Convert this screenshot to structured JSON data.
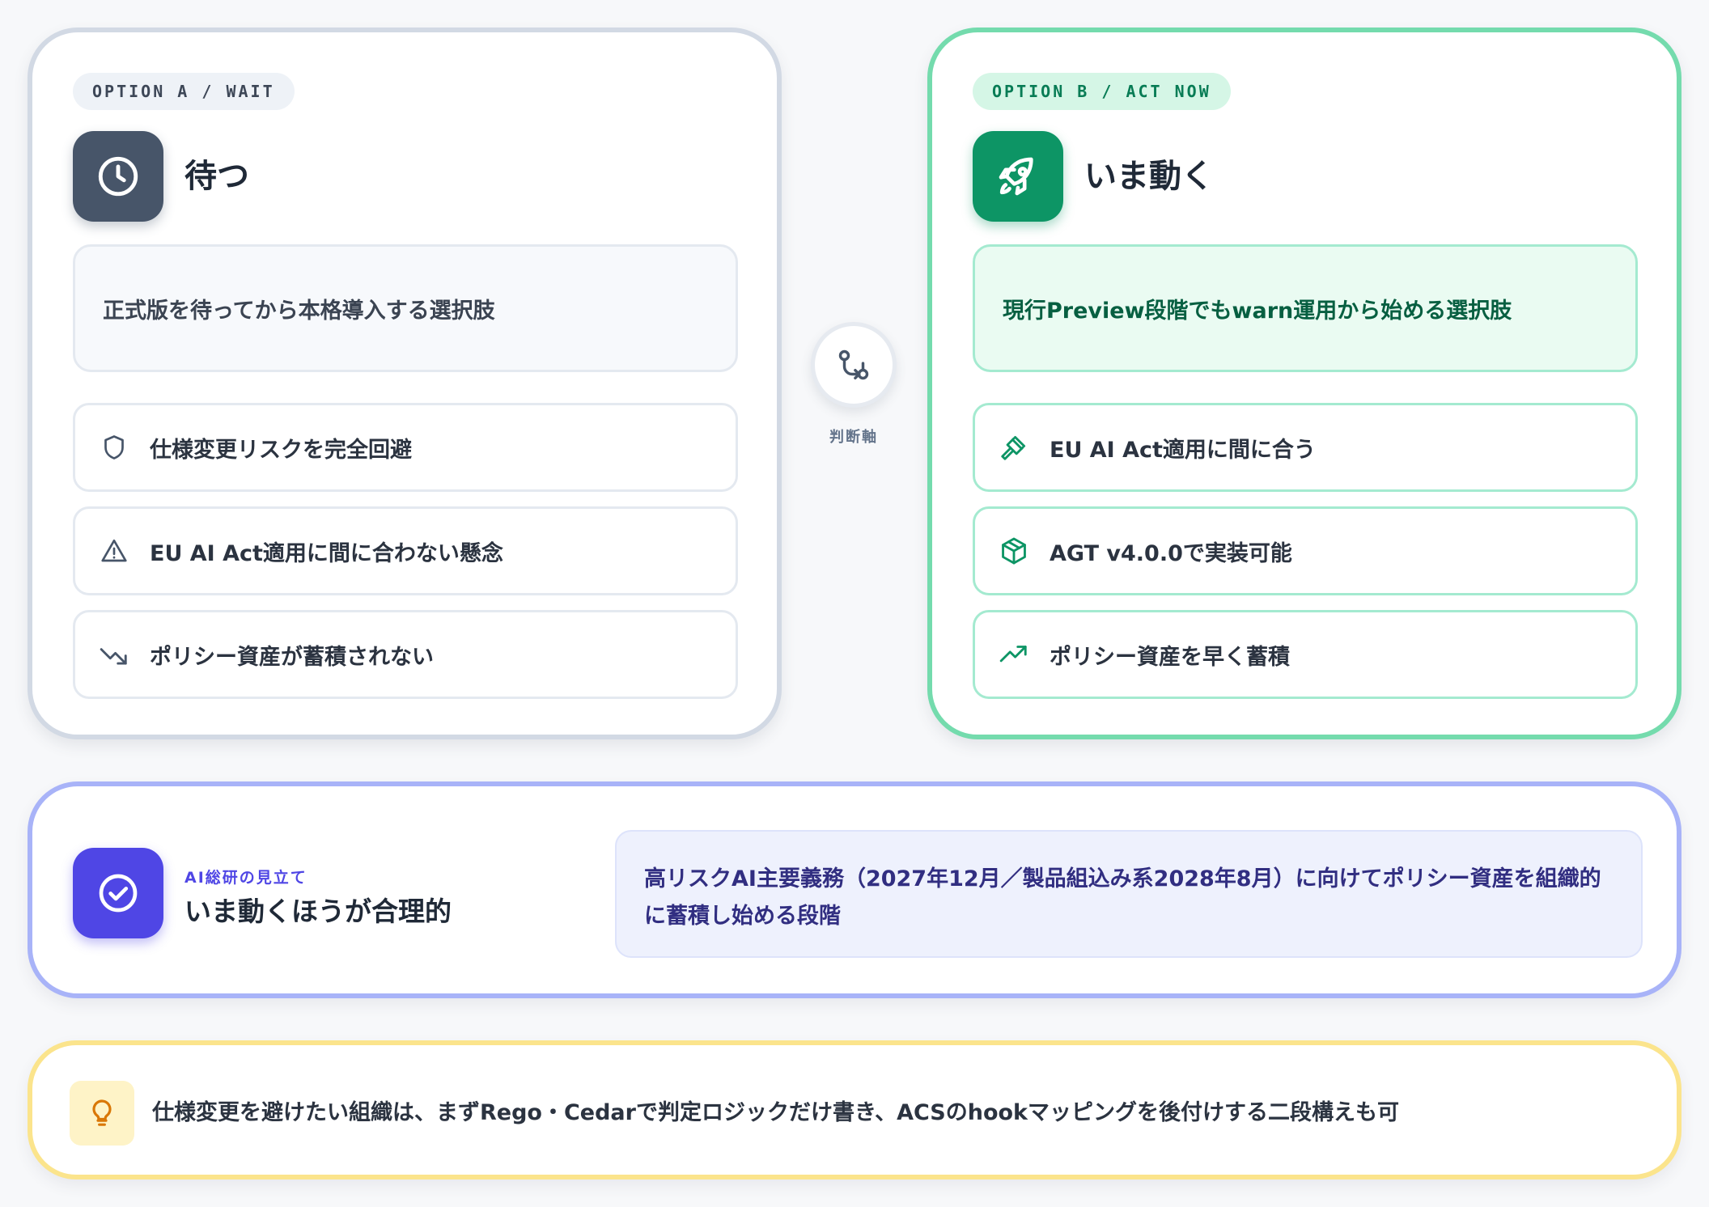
{
  "option_a": {
    "badge": "OPTION A / WAIT",
    "title": "待つ",
    "icon": "clock-icon",
    "description": "正式版を待ってから本格導入する選択肢",
    "points": [
      {
        "icon": "shield-icon",
        "text": "仕様変更リスクを完全回避"
      },
      {
        "icon": "warning-icon",
        "text": "EU AI Act適用に間に合わない懸念"
      },
      {
        "icon": "trending-down-icon",
        "text": "ポリシー資産が蓄積されない"
      }
    ]
  },
  "option_b": {
    "badge": "OPTION B / ACT NOW",
    "title": "いま動く",
    "icon": "rocket-icon",
    "description": "現行Preview段階でもwarn運用から始める選択肢",
    "points": [
      {
        "icon": "gavel-icon",
        "text": "EU AI Act適用に間に合う"
      },
      {
        "icon": "package-icon",
        "text": "AGT v4.0.0で実装可能"
      },
      {
        "icon": "trending-up-icon",
        "text": "ポリシー資産を早く蓄積"
      }
    ]
  },
  "axis": {
    "icon": "compare-icon",
    "label": "判断軸"
  },
  "verdict": {
    "icon": "check-circle-icon",
    "kicker": "AI総研の見立て",
    "title": "いま動くほうが合理的",
    "detail_line1": "高リスクAI主要義務（2027年12月／製品組込み系2028年8月）に向けてポリシー資産を組織的",
    "detail_line2": "に蓄積し始める段階"
  },
  "note": {
    "icon": "lightbulb-icon",
    "text": "仕様変更を避けたい組織は、まずRego・Cedarで判定ロジックだけ書き、ACSのhookマッピングを後付けする二段構えも可"
  },
  "colors": {
    "option_a_border": "#d2d9e4",
    "option_b_border": "#74dbad",
    "option_b_accent": "#0d9565",
    "verdict_accent": "#4f46e5",
    "note_border": "#fbe48c"
  }
}
